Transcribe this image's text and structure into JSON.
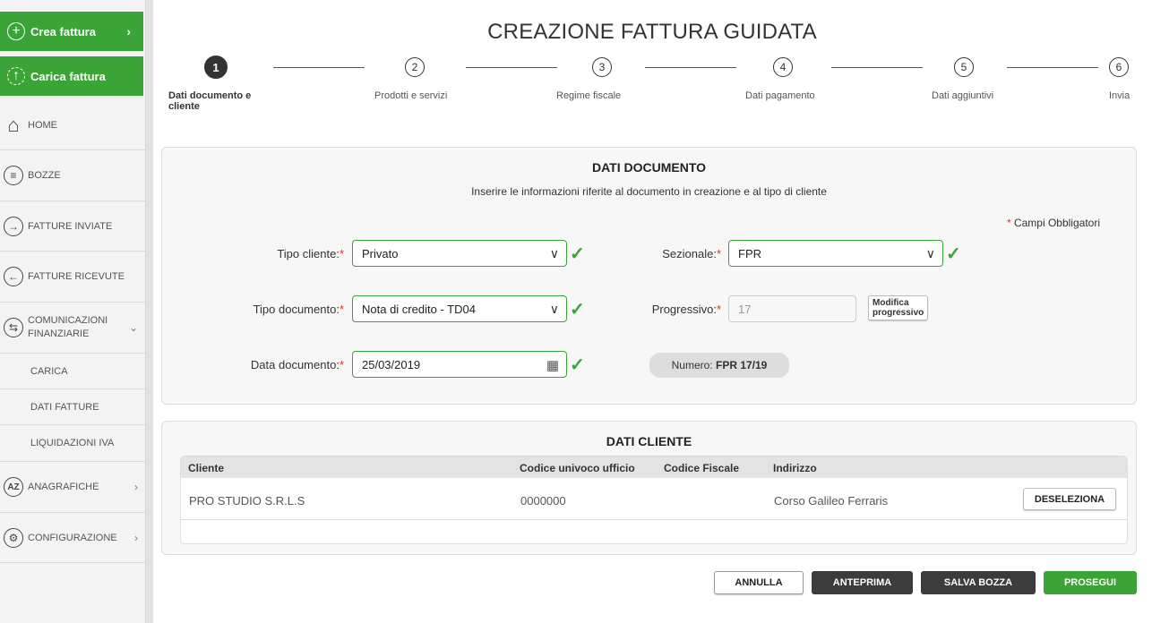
{
  "sidebar": {
    "crea": "Crea fattura",
    "carica": "Carica fattura",
    "items": [
      {
        "label": "HOME"
      },
      {
        "label": "BOZZE"
      },
      {
        "label": "FATTURE INVIATE"
      },
      {
        "label": "FATTURE RICEVUTE"
      },
      {
        "label": "COMUNICAZIONI FINANZIARIE"
      },
      {
        "label": "CARICA"
      },
      {
        "label": "DATI FATTURE"
      },
      {
        "label": "LIQUIDAZIONI IVA"
      },
      {
        "label": "ANAGRAFICHE"
      },
      {
        "label": "CONFIGURAZIONE"
      }
    ]
  },
  "title": "CREAZIONE FATTURA GUIDATA",
  "steps": [
    {
      "n": "1",
      "label": "Dati documento e cliente"
    },
    {
      "n": "2",
      "label": "Prodotti e servizi"
    },
    {
      "n": "3",
      "label": "Regime fiscale"
    },
    {
      "n": "4",
      "label": "Dati pagamento"
    },
    {
      "n": "5",
      "label": "Dati aggiuntivi"
    },
    {
      "n": "6",
      "label": "Invia"
    }
  ],
  "doc": {
    "title": "DATI DOCUMENTO",
    "subtitle": "Inserire le informazioni riferite al documento in creazione e al tipo di cliente",
    "required_note": "Campi Obbligatori",
    "asterisk": "*",
    "tipo_cliente_label": "Tipo cliente:",
    "tipo_cliente_value": "Privato",
    "tipo_documento_label": "Tipo documento:",
    "tipo_documento_value": "Nota di credito - TD04",
    "data_label": "Data documento:",
    "data_value": "25/03/2019",
    "sezionale_label": "Sezionale:",
    "sezionale_value": "FPR",
    "progressivo_label": "Progressivo:",
    "progressivo_value": "17",
    "modifica_line1": "Modifica",
    "modifica_line2": "progressivo",
    "numero_label": "Numero:",
    "numero_value": "FPR 17/19"
  },
  "cliente": {
    "title": "DATI CLIENTE",
    "headers": [
      "Cliente",
      "Codice univoco ufficio",
      "Codice Fiscale",
      "Indirizzo"
    ],
    "row": {
      "cliente": "PRO STUDIO S.R.L.S",
      "codice": "0000000",
      "cf": "",
      "indirizzo": "Corso Galileo Ferraris"
    },
    "deseleziona": "DESELEZIONA"
  },
  "footer": {
    "annulla": "ANNULLA",
    "anteprima": "ANTEPRIMA",
    "salva": "SALVA BOZZA",
    "prosegui": "PROSEGUI"
  },
  "colors": {
    "green": "#3aa437",
    "dark": "#3c3c3c",
    "required": "#d9342b"
  }
}
